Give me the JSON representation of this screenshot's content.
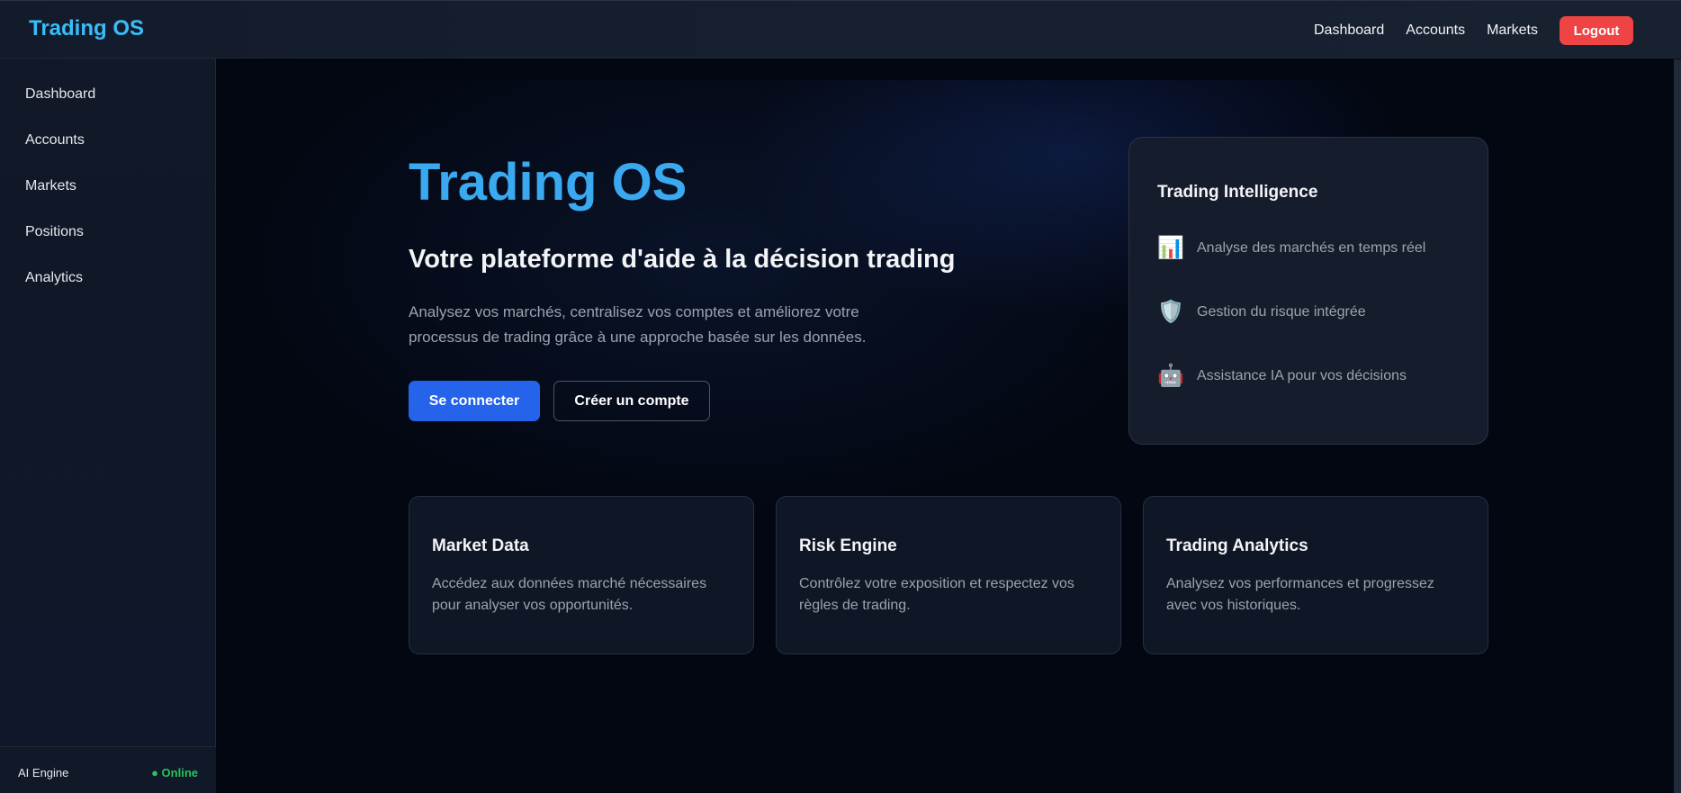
{
  "header": {
    "brand": "Trading OS",
    "nav": [
      "Dashboard",
      "Accounts",
      "Markets"
    ],
    "logout_label": "Logout"
  },
  "sidebar": {
    "items": [
      "Dashboard",
      "Accounts",
      "Markets",
      "Positions",
      "Analytics"
    ],
    "footer": {
      "label": "AI Engine",
      "status": "● Online",
      "status_color": "#22c55e"
    }
  },
  "hero": {
    "title": "Trading OS",
    "subtitle": "Votre plateforme d'aide à la décision trading",
    "description": "Analysez vos marchés, centralisez vos comptes et améliorez votre processus de trading grâce à une approche basée sur les données.",
    "primary_button": "Se connecter",
    "secondary_button": "Créer un compte"
  },
  "intelligence": {
    "title": "Trading Intelligence",
    "items": [
      {
        "icon": "bar-chart-icon",
        "glyph": "📊",
        "text": "Analyse des marchés en temps réel"
      },
      {
        "icon": "shield-icon",
        "glyph": "🛡️",
        "text": "Gestion du risque intégrée"
      },
      {
        "icon": "robot-icon",
        "glyph": "🤖",
        "text": "Assistance IA pour vos décisions"
      }
    ]
  },
  "features": [
    {
      "title": "Market Data",
      "description": "Accédez aux données marché nécessaires pour analyser vos opportunités."
    },
    {
      "title": "Risk Engine",
      "description": "Contrôlez votre exposition et respectez vos règles de trading."
    },
    {
      "title": "Trading Analytics",
      "description": "Analysez vos performances et progressez avec vos historiques."
    }
  ],
  "colors": {
    "accent": "#38bdf8",
    "primary": "#2563eb",
    "danger": "#ef4444",
    "background": "#030712"
  }
}
